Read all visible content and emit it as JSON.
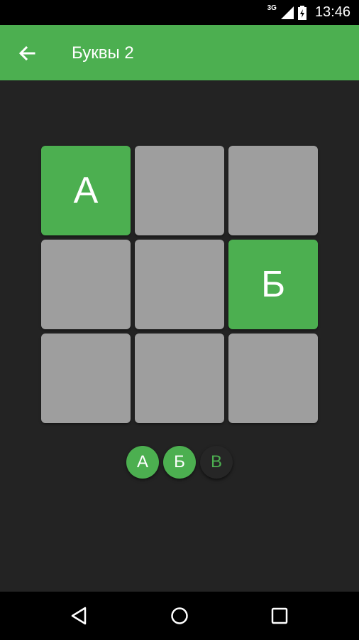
{
  "status_bar": {
    "network": "3G",
    "time": "13:46"
  },
  "toolbar": {
    "title": "Буквы 2"
  },
  "grid": {
    "cells": [
      "А",
      "",
      "",
      "",
      "",
      "Б",
      "",
      "",
      ""
    ]
  },
  "letters": [
    {
      "letter": "А",
      "found": true
    },
    {
      "letter": "Б",
      "found": true
    },
    {
      "letter": "В",
      "found": false
    }
  ],
  "colors": {
    "accent": "#4caf50",
    "tile": "#9e9e9e",
    "background": "#232323"
  },
  "icons": {
    "back": "arrow-left-icon",
    "nav_back": "triangle-back-icon",
    "nav_home": "circle-home-icon",
    "nav_recents": "square-recents-icon"
  }
}
